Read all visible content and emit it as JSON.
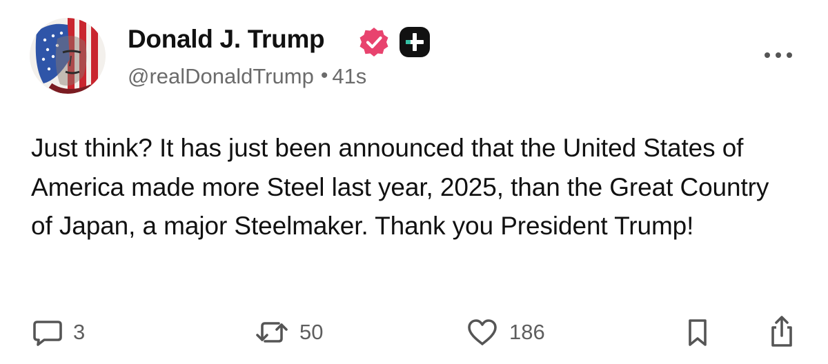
{
  "post": {
    "author": {
      "display_name": "Donald J. Trump",
      "handle": "@realDonaldTrump",
      "verified_icon": "verified-badge-icon",
      "extra_badge_icon": "plus-badge-icon",
      "avatar_description_icon": "avatar"
    },
    "separator": "•",
    "timestamp": "41s",
    "more_menu_icon": "more-horizontal-icon",
    "text": "Just think? It has just been announced that the United States of America made more Steel last year, 2025, than the Great Country of Japan, a major Steelmaker. Thank you President Trump!",
    "actions": {
      "reply_count": "3",
      "repost_count": "50",
      "like_count": "186",
      "reply_icon": "comment-icon",
      "repost_icon": "repost-icon",
      "like_icon": "heart-icon",
      "bookmark_icon": "bookmark-icon",
      "share_icon": "share-icon"
    }
  },
  "colors": {
    "text_primary": "#111111",
    "text_secondary": "#6b6b6b",
    "verified_badge": "#e8436e",
    "plus_badge": "#111111",
    "plus_badge_accent": "#35c2a6"
  }
}
